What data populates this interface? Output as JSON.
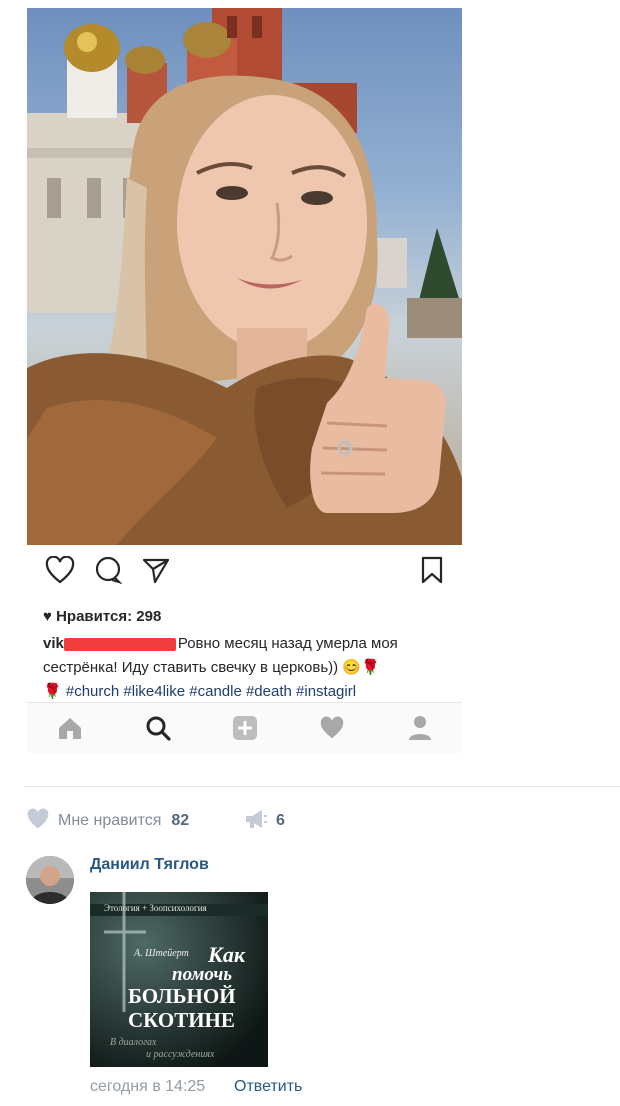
{
  "instagram": {
    "likes_label": "♥ Нравится: 298",
    "username_visible": "vik",
    "caption_text": "Ровно месяц назад умерла моя сестрёнка! Иду ставить свечку в церковь)) 😊🌹",
    "hashtag_emoji": "🌹",
    "hashtags": "#church #like4like #candle #death #instagirl",
    "icons": [
      "heart-icon",
      "comment-icon",
      "send-icon",
      "bookmark-icon"
    ],
    "nav_icons": [
      "home-icon",
      "search-icon",
      "add-icon",
      "activity-heart-icon",
      "profile-icon"
    ]
  },
  "vk": {
    "like_label": "Мне нравится",
    "like_count": "82",
    "share_count": "6",
    "comment": {
      "author": "Даниил Тяглов",
      "time": "сегодня в 14:25",
      "reply": "Ответить",
      "book": {
        "series": "Этология + Зоопсихология",
        "author": "А. Штейерт",
        "title_line1": "Как",
        "title_line2": "помочь",
        "title_line3": "БОЛЬНОЙ",
        "title_line4": "СКОТИНЕ",
        "subtitle_line1": "В диалогах",
        "subtitle_line2": "и рассуждениях"
      }
    }
  },
  "colors": {
    "vk_link": "#2a5885",
    "vk_gray": "#818c99",
    "ig_text": "#262626",
    "ig_hashtag": "#1e3d6b",
    "redaction": "#f03c3c"
  }
}
